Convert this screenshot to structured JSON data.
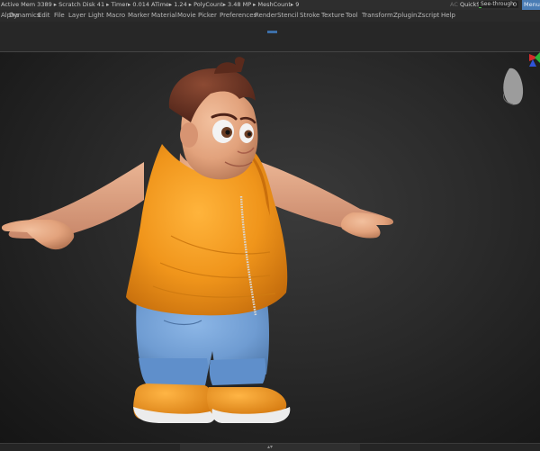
{
  "status": {
    "text": "Active Mem 3389 ▸ Scratch Disk 41 ▸ Timer▸ 0.014 ATime▸ 1.24 ▸ PolyCount▸ 3.48 MP  ▸ MeshCount▸ 9",
    "ac": "AC",
    "quicksave": "QuickSave",
    "seethrough_label": "See-through",
    "seethrough_value": "0",
    "seethrough_fraction": 0,
    "menus_label": "Menus"
  },
  "menu": {
    "items": [
      "Alpha",
      "Dynamics",
      "Edit",
      "File",
      "Layer",
      "Light",
      "Macro",
      "Marker",
      "Material",
      "Movie",
      "Picker",
      "Preferences",
      "Render",
      "Stencil",
      "Stroke",
      "Texture",
      "Tool",
      "Transform",
      "Zplugin",
      "Zscript",
      "Help"
    ]
  },
  "bottom": {
    "handle_glyph": "▴▾"
  },
  "colors": {
    "accent": "#4a7cb4",
    "vest": "#f39a1c",
    "jeans": "#6d9bd4",
    "skin": "#e5a983",
    "hair": "#6a3322",
    "shoe": "#f09a20",
    "sole": "#e8e8e8"
  }
}
